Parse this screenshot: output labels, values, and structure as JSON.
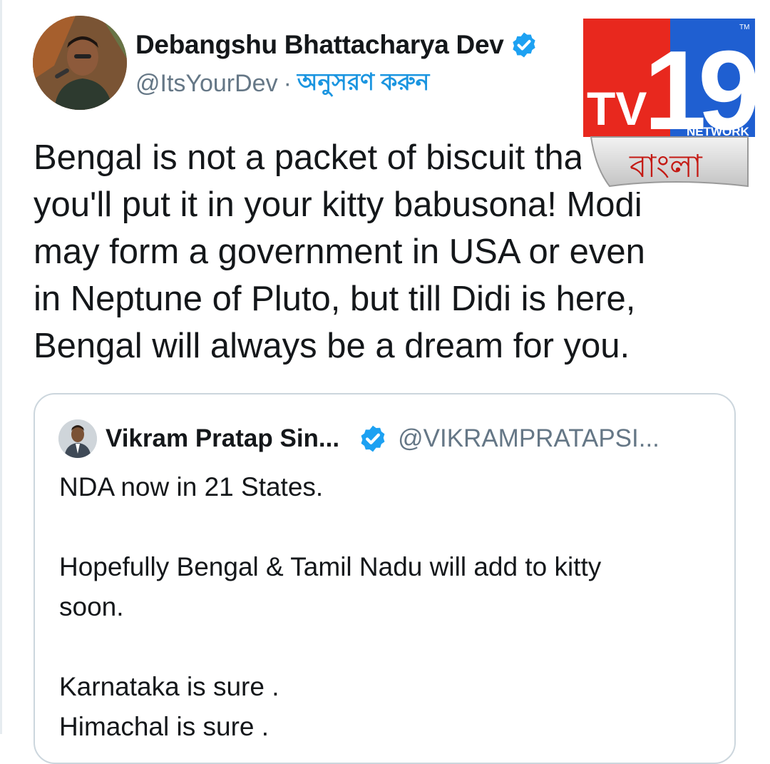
{
  "tweet": {
    "author": {
      "display_name": "Debangshu Bhattacharya Dev",
      "handle": "@ItsYourDev",
      "separator": "·",
      "follow_label": "অনুসরণ করুন",
      "verified_icon": "verified-badge-icon"
    },
    "text": "Bengal is not a packet of biscuit that\nyou'll put it in your kitty babusona! Modi\nmay form a government in USA or even\nin Neptune of Pluto, but till Didi is here,\nBengal will always be a dream for you."
  },
  "quoted_tweet": {
    "display_name": "Vikram Pratap Sin...",
    "handle": "@VIKRAMPRATAPSI...",
    "text": "NDA now in 21 States.\n\nHopefully Bengal & Tamil Nadu will add to kitty\nsoon.\n\nKarnataka is sure .\nHimachal is sure ."
  },
  "watermark": {
    "brand": "TV19",
    "network_label": "NETWORK",
    "tm": "TM",
    "language_label": "বাংলা"
  },
  "colors": {
    "accent_blue": "#1b95e0",
    "verified_blue": "#1da1f2",
    "logo_red": "#e8281e",
    "logo_blue": "#1f5fd1",
    "text_primary": "#14171a",
    "text_secondary": "#657786"
  }
}
